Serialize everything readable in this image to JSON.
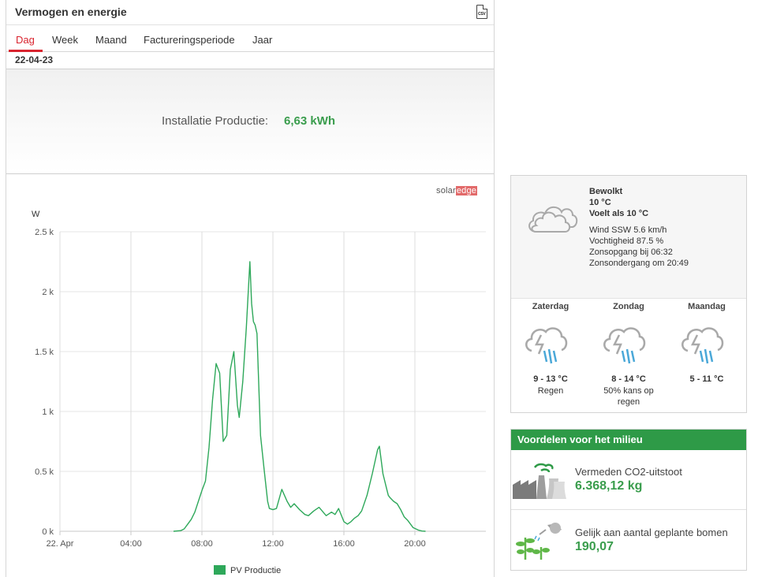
{
  "power_panel": {
    "title": "Vermogen en energie",
    "csv_icon_text": "CSV",
    "tabs": [
      "Dag",
      "Week",
      "Maand",
      "Factureringsperiode",
      "Jaar"
    ],
    "active_tab": "Dag",
    "date": "22-04-23",
    "summary_label": "Installatie Productie:",
    "summary_value": "6,63 kWh",
    "brand_solar": "solar",
    "brand_edge": "edge"
  },
  "chart_data": {
    "type": "line",
    "ylabel": "W",
    "y_tick_labels": [
      "0 k",
      "0.5 k",
      "1 k",
      "1.5 k",
      "2 k",
      "2.5 k"
    ],
    "ylim": [
      0,
      2500
    ],
    "x_tick_labels": [
      "22. Apr",
      "04:00",
      "08:00",
      "12:00",
      "16:00",
      "20:00"
    ],
    "xlim_hours": [
      0,
      24
    ],
    "grid": true,
    "legend_position": "bottom",
    "series": [
      {
        "name": "PV Productie",
        "color": "#2ea85a",
        "x_hours": [
          6.4,
          6.8,
          7.0,
          7.2,
          7.4,
          7.6,
          7.8,
          8.0,
          8.2,
          8.4,
          8.6,
          8.8,
          9.0,
          9.2,
          9.4,
          9.6,
          9.8,
          10.0,
          10.1,
          10.3,
          10.5,
          10.7,
          10.8,
          10.9,
          11.0,
          11.1,
          11.3,
          11.5,
          11.7,
          11.8,
          12.0,
          12.2,
          12.5,
          12.8,
          13.0,
          13.2,
          13.5,
          13.8,
          14.0,
          14.3,
          14.6,
          15.0,
          15.3,
          15.5,
          15.7,
          16.0,
          16.2,
          16.4,
          16.6,
          16.8,
          17.0,
          17.3,
          17.6,
          17.9,
          18.0,
          18.2,
          18.4,
          18.5,
          18.6,
          18.8,
          19.0,
          19.2,
          19.4,
          19.6,
          19.9,
          20.2,
          20.4,
          20.6
        ],
        "values": [
          0,
          5,
          20,
          60,
          100,
          160,
          250,
          340,
          420,
          700,
          1100,
          1400,
          1320,
          750,
          800,
          1350,
          1500,
          1050,
          950,
          1250,
          1700,
          2250,
          1900,
          1750,
          1720,
          1650,
          800,
          520,
          250,
          190,
          180,
          190,
          350,
          250,
          200,
          230,
          180,
          140,
          130,
          170,
          200,
          130,
          160,
          140,
          190,
          80,
          60,
          80,
          110,
          130,
          170,
          300,
          480,
          680,
          710,
          480,
          360,
          300,
          280,
          250,
          230,
          180,
          120,
          90,
          30,
          10,
          2,
          0
        ]
      }
    ]
  },
  "weather": {
    "condition": "Bewolkt",
    "temp": "10 °C",
    "feels_like": "Voelt als 10 °C",
    "wind": "Wind SSW 5.6 km/h",
    "humidity": "Vochtigheid 87.5 %",
    "sunrise": "Zonsopgang bij 06:32",
    "sunset": "Zonsondergang om 20:49",
    "forecast": [
      {
        "day": "Zaterdag",
        "temp": "9 - 13 °C",
        "desc": "Regen"
      },
      {
        "day": "Zondag",
        "temp": "8 - 14 °C",
        "desc": "50% kans op regen"
      },
      {
        "day": "Maandag",
        "temp": "5 - 11 °C",
        "desc": ""
      }
    ]
  },
  "environment": {
    "title": "Voordelen voor het milieu",
    "co2_label": "Vermeden CO2-uitstoot",
    "co2_value": "6.368,12 kg",
    "trees_label": "Gelijk aan aantal geplante bomen",
    "trees_value": "190,07"
  }
}
